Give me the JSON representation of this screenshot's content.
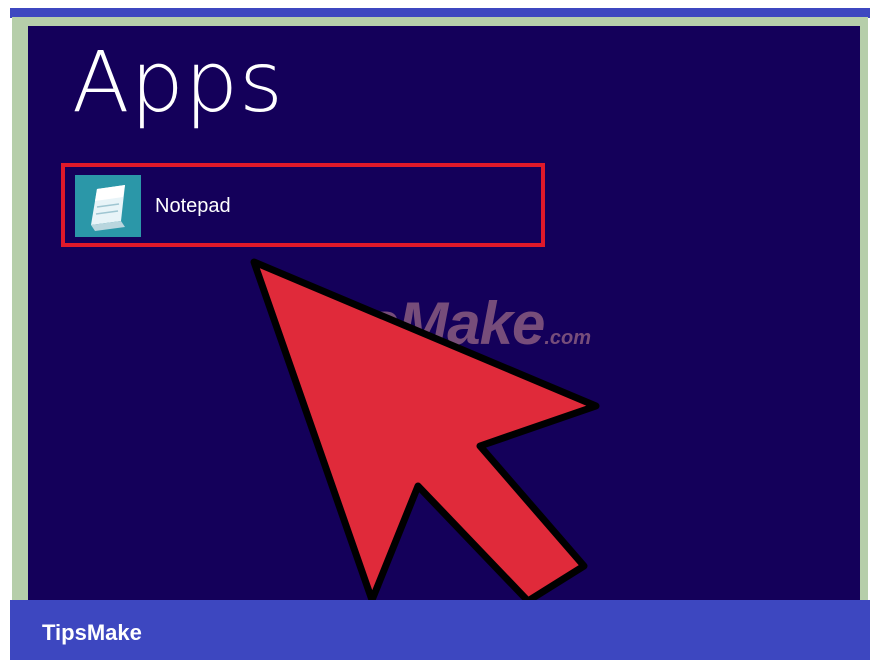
{
  "screen": {
    "title": "Apps",
    "background_color": "#14005a"
  },
  "app_result": {
    "label": "Notepad",
    "icon": "notepad-icon",
    "highlight_color": "#e0192a"
  },
  "pointer": {
    "icon": "arrow-pointer-icon",
    "color": "#e02a3a"
  },
  "watermark": {
    "text": "TipsMake",
    "suffix": ".com"
  },
  "footer": {
    "brand": "TipsMake",
    "color": "#3d47c0"
  }
}
